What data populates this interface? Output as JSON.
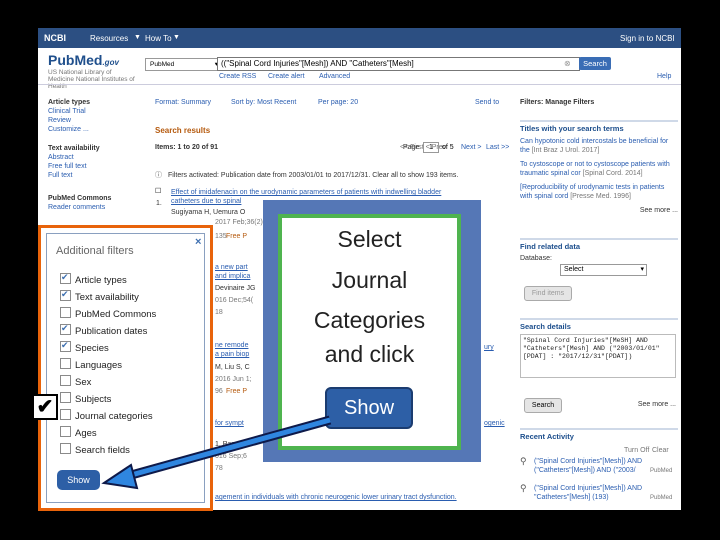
{
  "top_bar": {
    "ncbi": "NCBI",
    "resources": "Resources",
    "how_to": "How To",
    "sign_in": "Sign in to NCBI"
  },
  "logo": {
    "name": "PubMed",
    "suffix": ".gov",
    "line1": "US National Library of",
    "line2": "Medicine National Institutes of",
    "line3": "Health"
  },
  "search": {
    "db": "PubMed",
    "query": "((\"Spinal Cord Injuries\"[Mesh]) AND \"Catheters\"[Mesh]",
    "button": "Search",
    "links": [
      "Create RSS",
      "Create alert",
      "Advanced"
    ],
    "help": "Help"
  },
  "sidebar": {
    "article_types": {
      "title": "Article types",
      "items": [
        "Clinical Trial",
        "Review",
        "Customize ..."
      ]
    },
    "text_availability": {
      "title": "Text availability",
      "items": [
        "Abstract",
        "Free full text",
        "Full text"
      ]
    },
    "pubmed_commons": {
      "title": "PubMed Commons",
      "items": [
        "Reader comments"
      ]
    }
  },
  "format_bar": {
    "format": "Format: Summary",
    "sort": "Sort by: Most Recent",
    "per_page": "Per page: 20",
    "send_to": "Send to"
  },
  "results": {
    "heading": "Search results",
    "count": "Items: 1 to 20 of 91",
    "page_label": "Page",
    "page_value": "1",
    "page_of": "of 5",
    "next": "Next >",
    "last": "Last >>",
    "filter_note": "Filters activated: Publication date from 2003/01/01 to 2017/12/31. Clear all to show 193 items.",
    "items": [
      {
        "num": "1.",
        "title_a": "Effect of imidafenacin on the urodynamic parameters of patients with indwelling bladder",
        "title_b": "catheters due to spinal",
        "authors": "Sugiyama H, Uemura O",
        "source": "2017 Feb;36(2):",
        "id": "135",
        "extra": "Free P"
      },
      {
        "title_a": "a new part",
        "title_b": "and implica",
        "authors": "Devinaire JG",
        "source": "016 Dec;54(",
        "id": "18"
      },
      {
        "title_a": "ne remode",
        "title_b": "a pain biop",
        "authors": "M, Liu S, C",
        "source": "2016 Jun 1;",
        "id": "96",
        "extra": "Free P",
        "right": "ury"
      },
      {
        "title_a": "for sympt",
        "title_b": "1. Pan",
        "source": "016 Sep;6",
        "id": "78",
        "right": "ogenic"
      },
      {
        "title_a": "agement in individuals with chronic neurogenic lower urinary tract dysfunction."
      }
    ]
  },
  "right": {
    "manage_filters": "Filters: Manage Filters",
    "titles_box": {
      "title": "Titles with your search terms",
      "items": [
        {
          "text": "Can hypotonic cold intercostals be beneficial for the",
          "source": "[Int Braz J Urol. 2017]"
        },
        {
          "text": "To cystoscope or not to cystoscope patients with traumatic spinal cor",
          "source": "[Spinal Cord. 2014]"
        },
        {
          "text": "[Reproducibility of urodynamic tests in patients with spinal cord",
          "source": "[Presse Med. 1996]"
        }
      ],
      "see_more": "See more ..."
    },
    "related": {
      "title": "Find related data",
      "db_label": "Database:",
      "db_value": "Select",
      "button": "Find items"
    },
    "details": {
      "title": "Search details",
      "query": "\"Spinal Cord Injuries\"[MeSH] AND \"Catheters\"[Mesh] AND (\"2003/01/01\"[PDAT] : \"2017/12/31\"[PDAT])",
      "button": "Search",
      "see_more": "See more ..."
    },
    "activity": {
      "title": "Recent Activity",
      "turn_off": "Turn Off",
      "clear": "Clear",
      "items": [
        {
          "text": "(\"Spinal Cord Injuries\"[Mesh]) AND (\"Catheters\"[Mesh]) AND (\"2003/",
          "db": "PubMed"
        },
        {
          "text": "(\"Spinal Cord Injuries\"[Mesh]) AND \"Catheters\"[Mesh] (193)",
          "db": "PubMed"
        }
      ]
    }
  },
  "popup": {
    "title": "Additional filters",
    "close": "×",
    "options": [
      {
        "label": "Article types",
        "checked": true
      },
      {
        "label": "Text availability",
        "checked": true
      },
      {
        "label": "PubMed Commons",
        "checked": false
      },
      {
        "label": "Publication dates",
        "checked": true
      },
      {
        "label": "Species",
        "checked": true
      },
      {
        "label": "Languages",
        "checked": false
      },
      {
        "label": "Sex",
        "checked": false
      },
      {
        "label": "Subjects",
        "checked": false
      },
      {
        "label": "Journal categories",
        "checked": false
      },
      {
        "label": "Ages",
        "checked": false
      },
      {
        "label": "Search fields",
        "checked": false
      }
    ],
    "show_button": "Show",
    "big_check": "✔"
  },
  "callout": {
    "line1": "Select",
    "line2": "Journal",
    "line3": "Categories",
    "line4": "and click",
    "button": "Show"
  },
  "colors": {
    "bar": "#2c4f82",
    "link": "#2a5db0",
    "header": "#b55a0e",
    "orange_frame": "#e8630a",
    "callout_blue": "#5577b6",
    "callout_green": "#4fb44f",
    "show_blue": "#2d5fa6"
  }
}
